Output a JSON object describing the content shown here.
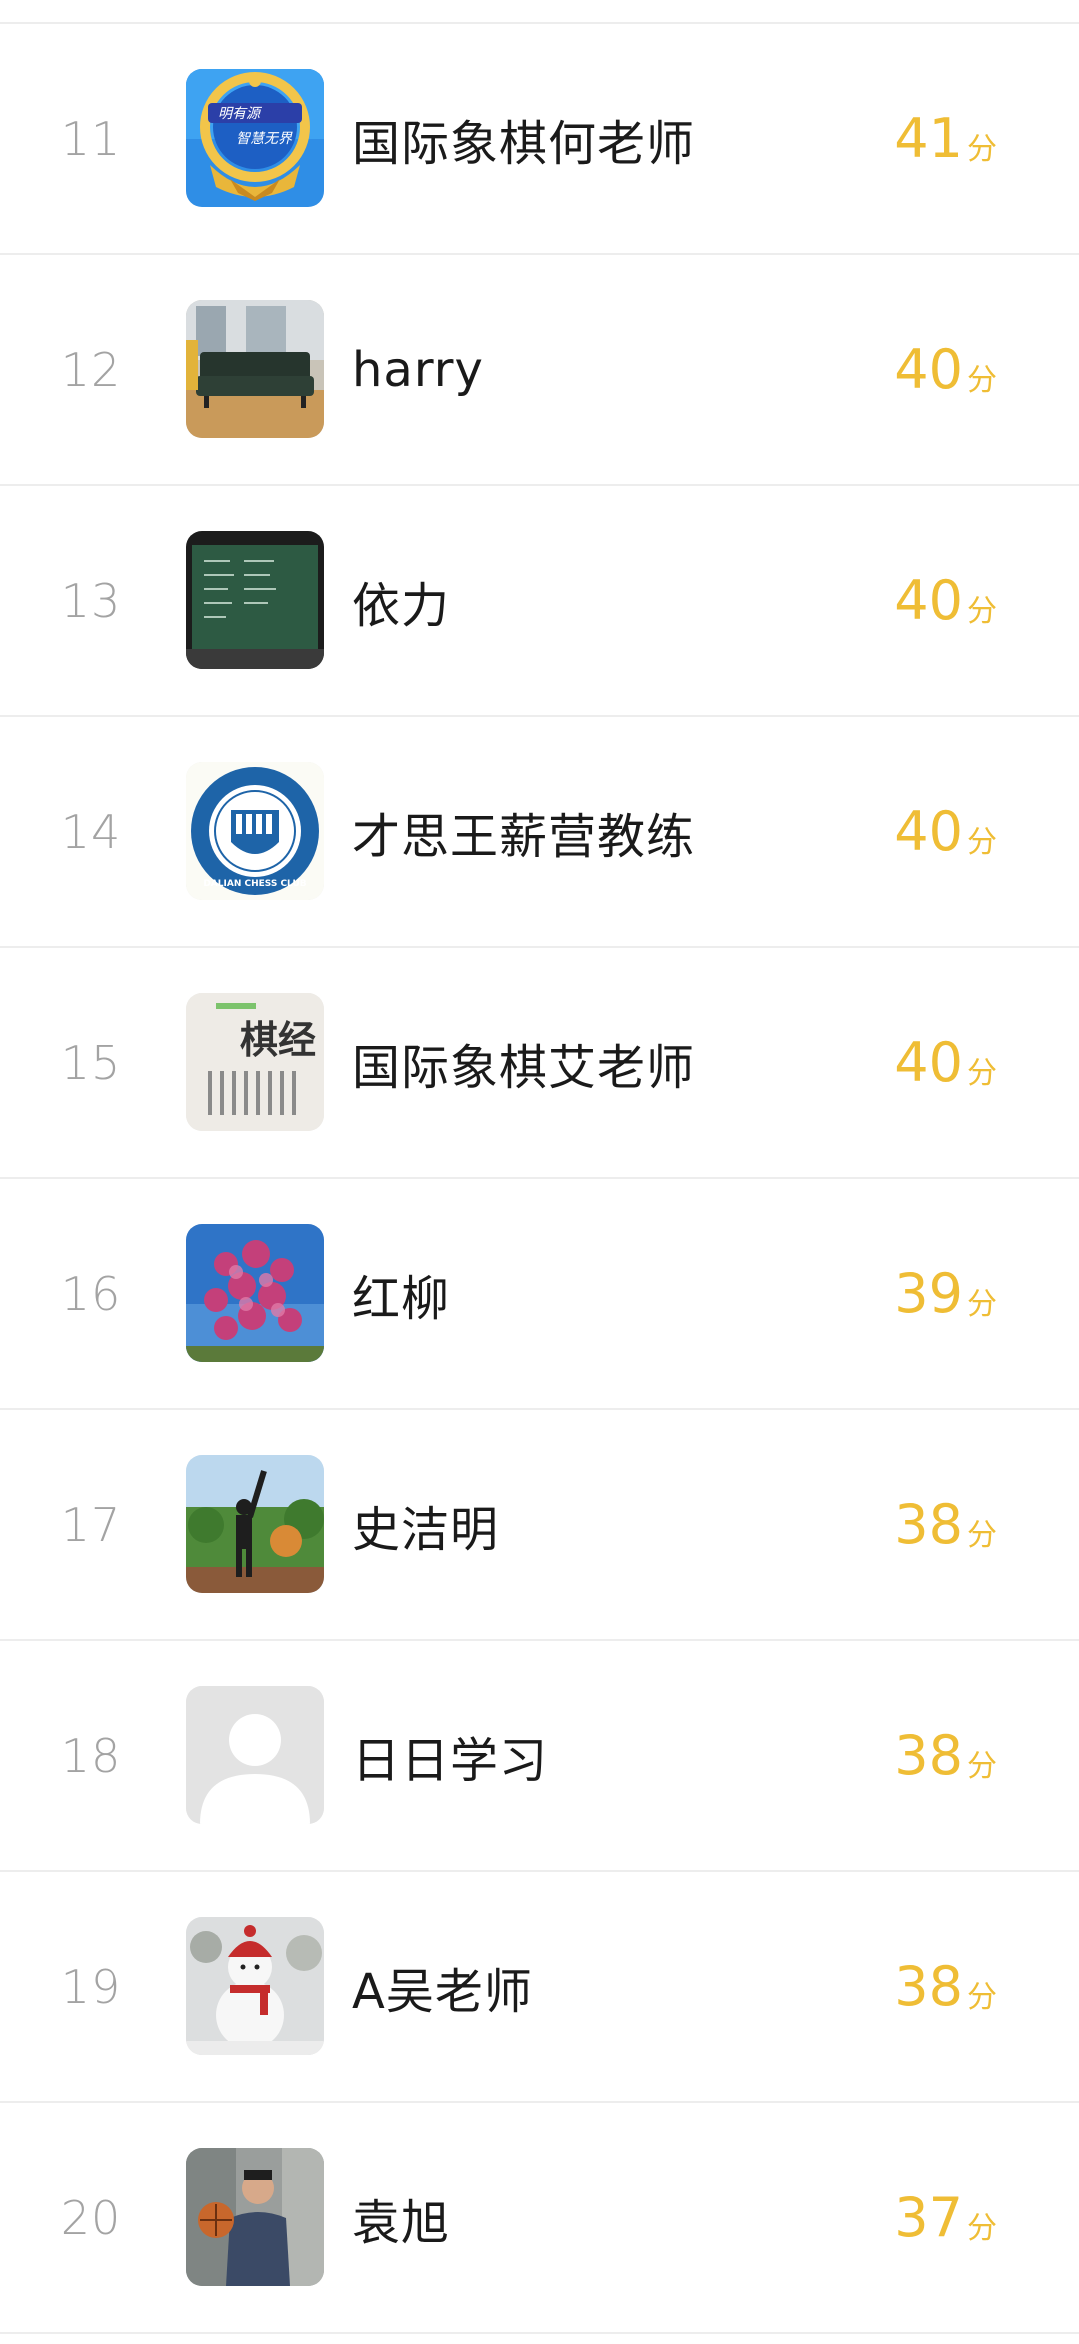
{
  "leaderboard": {
    "score_unit": "分",
    "rows": [
      {
        "rank": "11",
        "name": "国际象棋何老师",
        "score": "41",
        "avatar": "badge-logo-avatar"
      },
      {
        "rank": "12",
        "name": "harry",
        "score": "40",
        "avatar": "sofa-room-avatar"
      },
      {
        "rank": "13",
        "name": "依力",
        "score": "40",
        "avatar": "chalkboard-avatar"
      },
      {
        "rank": "14",
        "name": "才思王薪营教练",
        "score": "40",
        "avatar": "chess-club-logo-avatar"
      },
      {
        "rank": "15",
        "name": "国际象棋艾老师",
        "score": "40",
        "avatar": "calligraphy-avatar"
      },
      {
        "rank": "16",
        "name": "红柳",
        "score": "39",
        "avatar": "flower-tree-avatar"
      },
      {
        "rank": "17",
        "name": "史洁明",
        "score": "38",
        "avatar": "person-outdoor-avatar"
      },
      {
        "rank": "18",
        "name": "日日学习",
        "score": "38",
        "avatar": "default-user-avatar"
      },
      {
        "rank": "19",
        "name": "A吴老师",
        "score": "38",
        "avatar": "snowman-avatar"
      },
      {
        "rank": "20",
        "name": "袁旭",
        "score": "37",
        "avatar": "person-basketball-avatar"
      }
    ],
    "avatar_text": {
      "badge_line1": "明有源",
      "badge_line2": "智慧无界",
      "calligraphy": "棋经",
      "club_ring": "DALIAN CHESS CLUB"
    }
  },
  "colors": {
    "rank": "#a3a3a3",
    "name": "#1a1a1a",
    "score": "#efbd35",
    "divider": "#ededed"
  }
}
